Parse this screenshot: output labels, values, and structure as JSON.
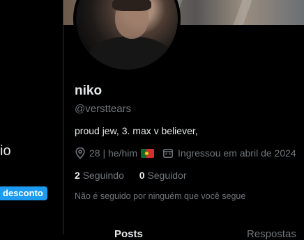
{
  "left_panel": {
    "fragment_text": "io",
    "discount_label": "desconto"
  },
  "profile": {
    "display_name": "niko",
    "handle": "@versttears",
    "bio": "proud jew, 3. max v believer,",
    "location": "28 | he/him",
    "joined": "Ingressou em abril de 2024",
    "following_count": "2",
    "following_label": "Seguindo",
    "followers_count": "0",
    "followers_label": "Seguidor",
    "not_followed_text": "Não é seguido por ninguém que você segue"
  },
  "tabs": [
    {
      "label": "Posts"
    },
    {
      "label": "Respostas"
    }
  ],
  "colors": {
    "background": "#000000",
    "text_primary": "#e7e9ea",
    "text_secondary": "#71767b",
    "accent": "#1d9bf0"
  },
  "icons": {
    "location": "location-pin-icon",
    "joined": "calendar-icon",
    "flag": "portugal-flag-icon"
  }
}
